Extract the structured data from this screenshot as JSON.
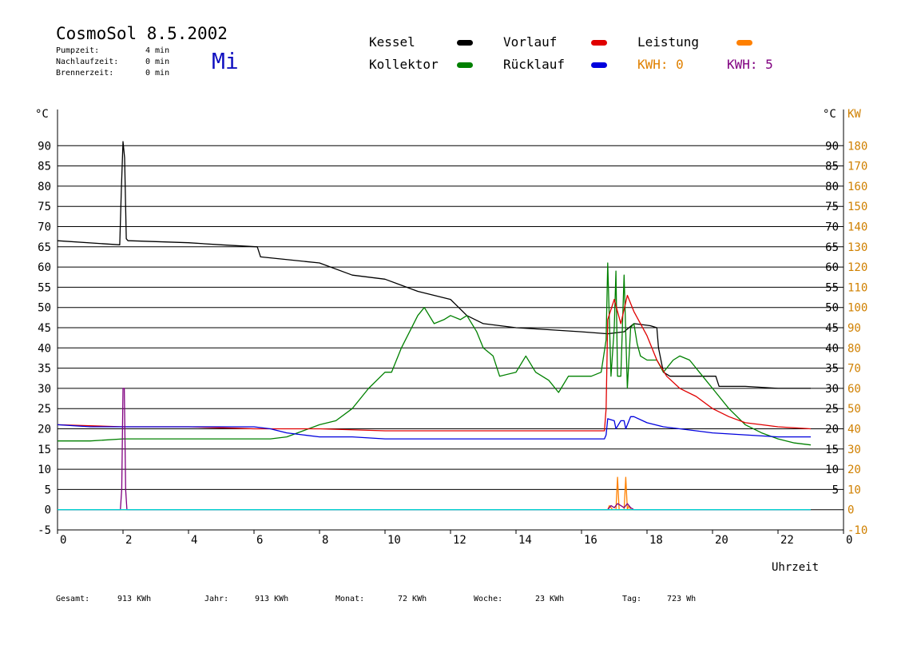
{
  "header": {
    "title": "CosmoSol 8.5.2002",
    "day": "Mi",
    "stats": [
      {
        "label": "Pumpzeit:",
        "value": "4 min"
      },
      {
        "label": "Nachlaufzeit:",
        "value": "0 min"
      },
      {
        "label": "Brennerzeit:",
        "value": "0 min"
      }
    ]
  },
  "legend": {
    "kessel": "Kessel",
    "kollektor": "Kollektor",
    "vorlauf": "Vorlauf",
    "ruecklauf": "Rücklauf",
    "leistung": "Leistung",
    "kwh1": "KWH: 0",
    "kwh2": "KWH: 5"
  },
  "colors": {
    "kessel": "#000000",
    "kollektor": "#008000",
    "vorlauf": "#e00000",
    "ruecklauf": "#0000dd",
    "leistung": "#ff8000",
    "kwh2": "#800080",
    "baseline": "#00d0d0",
    "axis_right": "#d08000"
  },
  "footer": [
    {
      "label": "Gesamt:",
      "value": "913 KWh"
    },
    {
      "label": "Jahr:",
      "value": "913 KWh"
    },
    {
      "label": "Monat:",
      "value": "72 KWh"
    },
    {
      "label": "Woche:",
      "value": "23 KWh"
    },
    {
      "label": "Tag:",
      "value": "723 Wh"
    }
  ],
  "chart_data": {
    "type": "line",
    "title": "CosmoSol 8.5.2002",
    "xlabel": "Uhrzeit",
    "ylabel_left": "°C",
    "ylabel_right_temp": "°C",
    "ylabel_right_power": "KW",
    "xlim": [
      0,
      24
    ],
    "ylim": [
      -5,
      95
    ],
    "x_ticks": [
      "0",
      "2",
      "4",
      "6",
      "8",
      "10",
      "12",
      "14",
      "16",
      "18",
      "20",
      "22",
      "0"
    ],
    "y_ticks_left": [
      "90",
      "85",
      "80",
      "75",
      "70",
      "65",
      "60",
      "55",
      "50",
      "45",
      "40",
      "35",
      "30",
      "25",
      "20",
      "15",
      "10",
      "5",
      "0",
      "-5"
    ],
    "y_ticks_right_temp": [
      "90",
      "85",
      "80",
      "75",
      "70",
      "65",
      "60",
      "55",
      "50",
      "45",
      "40",
      "35",
      "30",
      "25",
      "20",
      "15",
      "10",
      "5"
    ],
    "y_ticks_right_power": [
      "180",
      "170",
      "160",
      "150",
      "140",
      "130",
      "120",
      "110",
      "100",
      "90",
      "80",
      "70",
      "60",
      "50",
      "40",
      "30",
      "20",
      "10",
      "0",
      "-10"
    ],
    "grid": true,
    "series": [
      {
        "name": "Kessel",
        "key": "kessel",
        "x": [
          0,
          1.9,
          1.95,
          2.0,
          2.05,
          2.1,
          2.15,
          2.2,
          4,
          5,
          6.1,
          6.2,
          8,
          9,
          10,
          10.5,
          11,
          12,
          12.5,
          13,
          14,
          15,
          16,
          16.8,
          17.3,
          17.6,
          18.1,
          18.3,
          18.35,
          18.5,
          18.7,
          19.5,
          20.1,
          20.2,
          21,
          22,
          23
        ],
        "y": [
          66.5,
          65.5,
          79,
          91,
          87,
          67,
          66.5,
          66.5,
          66,
          65.5,
          65,
          62.5,
          61,
          58,
          57,
          55.5,
          54,
          52,
          48,
          46,
          45,
          44.5,
          44,
          43.5,
          44,
          46,
          45.5,
          45,
          40,
          34,
          33,
          33,
          33,
          30.5,
          30.5,
          30,
          30
        ]
      },
      {
        "name": "Kollektor",
        "key": "kollektor",
        "x": [
          0,
          1,
          2,
          3,
          4,
          5,
          6,
          6.5,
          7,
          7.5,
          8,
          8.5,
          9,
          9.5,
          10,
          10.2,
          10.5,
          11,
          11.2,
          11.5,
          11.8,
          12,
          12.3,
          12.5,
          12.8,
          13,
          13.3,
          13.5,
          14,
          14.3,
          14.6,
          15,
          15.3,
          15.6,
          16,
          16.3,
          16.6,
          16.75,
          16.8,
          16.9,
          17.0,
          17.05,
          17.1,
          17.2,
          17.3,
          17.4,
          17.5,
          17.6,
          17.7,
          17.8,
          18,
          18.3,
          18.5,
          18.8,
          19,
          19.3,
          19.6,
          20,
          20.5,
          21,
          21.5,
          22,
          22.5,
          23
        ],
        "y": [
          17,
          17,
          17.5,
          17.5,
          17.5,
          17.5,
          17.5,
          17.5,
          18,
          19.5,
          21,
          22,
          25,
          30,
          34,
          34,
          40,
          48,
          50,
          46,
          47,
          48,
          47,
          48,
          44,
          40,
          38,
          33,
          34,
          38,
          34,
          32,
          29,
          33,
          33,
          33,
          34,
          42,
          61,
          33,
          45,
          59,
          33,
          33,
          58,
          30,
          45,
          46,
          41,
          38,
          37,
          37,
          34,
          37,
          38,
          37,
          34,
          30,
          25,
          21,
          19,
          17.5,
          16.5,
          16
        ]
      },
      {
        "name": "Vorlauf",
        "key": "vorlauf",
        "x": [
          0,
          2,
          4,
          6,
          8,
          10,
          12,
          14,
          16,
          16.7,
          16.75,
          16.8,
          17.0,
          17.2,
          17.4,
          17.6,
          17.8,
          18,
          18.3,
          18.6,
          19,
          19.5,
          20,
          20.5,
          21,
          21.5,
          22,
          23
        ],
        "y": [
          21,
          20.5,
          20.5,
          20,
          20,
          19.5,
          19.5,
          19.5,
          19.5,
          19.5,
          25,
          47,
          52,
          46,
          53,
          49,
          46,
          43,
          37,
          33,
          30,
          28,
          25,
          23,
          21.5,
          21,
          20.5,
          20
        ]
      },
      {
        "name": "Rücklauf",
        "key": "ruecklauf",
        "x": [
          0,
          1,
          2,
          3,
          4,
          5,
          6,
          6.5,
          7,
          7.5,
          8,
          9,
          10,
          11,
          12,
          13,
          14,
          15,
          16,
          16.7,
          16.75,
          16.8,
          17,
          17.05,
          17.2,
          17.3,
          17.35,
          17.5,
          17.6,
          18,
          18.5,
          19,
          19.5,
          20,
          21,
          22,
          23
        ],
        "y": [
          21,
          20.5,
          20.5,
          20.5,
          20.5,
          20.5,
          20.5,
          20,
          19,
          18.5,
          18,
          18,
          17.5,
          17.5,
          17.5,
          17.5,
          17.5,
          17.5,
          17.5,
          17.5,
          18.5,
          22.5,
          22,
          20,
          22,
          22,
          20,
          23,
          23,
          21.5,
          20.5,
          20,
          19.5,
          19,
          18.5,
          18,
          18
        ]
      },
      {
        "name": "Leistung",
        "key": "leistung",
        "unit": "KW",
        "x": [
          0,
          16.8,
          16.85,
          16.95,
          17.05,
          17.1,
          17.15,
          17.25,
          17.3,
          17.35,
          17.4,
          17.45,
          17.5,
          23
        ],
        "y": [
          0,
          0,
          2,
          0,
          0,
          16,
          0,
          0,
          0,
          16,
          0,
          2,
          0,
          0
        ]
      },
      {
        "name": "KWH: 5",
        "key": "kwh2",
        "unit": "KW",
        "x": [
          0,
          1.92,
          1.96,
          2.0,
          2.04,
          2.08,
          2.12,
          16.8,
          16.9,
          17.0,
          17.1,
          17.2,
          17.3,
          17.4,
          17.5,
          17.6,
          23
        ],
        "y": [
          0,
          0,
          10,
          60,
          60,
          10,
          0,
          0,
          2,
          1,
          3,
          2,
          1,
          3,
          1,
          0,
          0
        ]
      },
      {
        "name": "Baseline",
        "key": "baseline",
        "x": [
          0,
          23
        ],
        "y": [
          0,
          0
        ]
      }
    ]
  }
}
